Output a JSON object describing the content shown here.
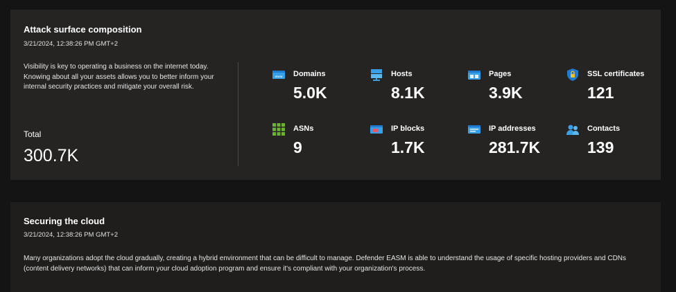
{
  "attack_surface": {
    "title": "Attack surface composition",
    "timestamp": "3/21/2024, 12:38:26 PM GMT+2",
    "description": "Visibility is key to operating a business on the internet today. Knowing about all your assets allows you to better inform your internal security practices and mitigate your overall risk.",
    "total_label": "Total",
    "total_value": "300.7K",
    "metrics": [
      {
        "label": "Domains",
        "value": "5.0K",
        "icon": "domains-icon"
      },
      {
        "label": "Hosts",
        "value": "8.1K",
        "icon": "hosts-icon"
      },
      {
        "label": "Pages",
        "value": "3.9K",
        "icon": "pages-icon"
      },
      {
        "label": "SSL certificates",
        "value": "121",
        "icon": "ssl-certificate-icon"
      },
      {
        "label": "ASNs",
        "value": "9",
        "icon": "asn-icon"
      },
      {
        "label": "IP blocks",
        "value": "1.7K",
        "icon": "ip-blocks-icon"
      },
      {
        "label": "IP addresses",
        "value": "281.7K",
        "icon": "ip-addresses-icon"
      },
      {
        "label": "Contacts",
        "value": "139",
        "icon": "contacts-icon"
      }
    ]
  },
  "securing_cloud": {
    "title": "Securing the cloud",
    "timestamp": "3/21/2024, 12:38:26 PM GMT+2",
    "description": "Many organizations adopt the cloud gradually, creating a hybrid environment that can be difficult to manage. Defender EASM is able to understand the usage of specific hosting providers and CDNs (content delivery networks) that can inform your cloud adoption program and ensure it's compliant with your organization's process."
  },
  "colors": {
    "page_bg": "#141414",
    "card_bg": "#252423",
    "icon_blue": "#3aa0e6",
    "icon_green": "#6bb32e",
    "icon_shield": "#1f7ad1"
  }
}
